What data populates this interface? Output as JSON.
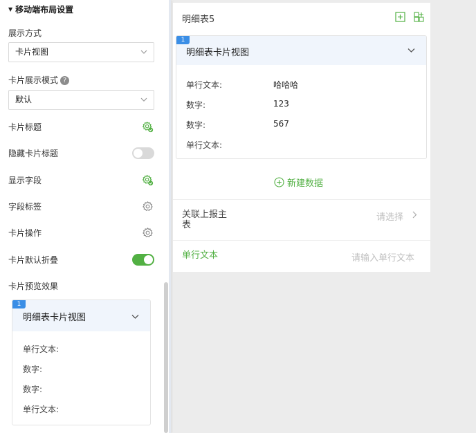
{
  "left_panel": {
    "section_title": "移动端布局设置",
    "display_mode": {
      "label": "展示方式",
      "value": "卡片视图"
    },
    "card_mode": {
      "label": "卡片展示模式",
      "help": "?",
      "value": "默认"
    },
    "rows": [
      {
        "label": "卡片标题",
        "control": "gear-check"
      },
      {
        "label": "隐藏卡片标题",
        "control": "toggle",
        "on": false
      },
      {
        "label": "显示字段",
        "control": "gear-check"
      },
      {
        "label": "字段标签",
        "control": "gear"
      },
      {
        "label": "卡片操作",
        "control": "gear"
      },
      {
        "label": "卡片默认折叠",
        "control": "toggle",
        "on": true
      }
    ],
    "preview_label": "卡片预览效果",
    "preview_card": {
      "badge": "1",
      "title": "明细表卡片视图",
      "fields": [
        "单行文本:",
        "数字:",
        "数字:",
        "单行文本:"
      ]
    }
  },
  "right_panel": {
    "title": "明细表5",
    "card": {
      "badge": "1",
      "title": "明细表卡片视图",
      "fields": [
        {
          "label": "单行文本:",
          "value": "哈哈哈"
        },
        {
          "label": "数字:",
          "value": "123"
        },
        {
          "label": "数字:",
          "value": "567"
        },
        {
          "label": "单行文本:",
          "value": ""
        }
      ]
    },
    "new_data": "新建数据",
    "form": {
      "related_label_line1": "关联上报主",
      "related_label_line2": "表",
      "related_placeholder": "请选择",
      "text_label": "单行文本",
      "text_placeholder": "请输入单行文本"
    }
  },
  "colors": {
    "accent_green": "#52b043",
    "badge_blue": "#3a8ee6",
    "card_header": "#f0f5fc"
  }
}
